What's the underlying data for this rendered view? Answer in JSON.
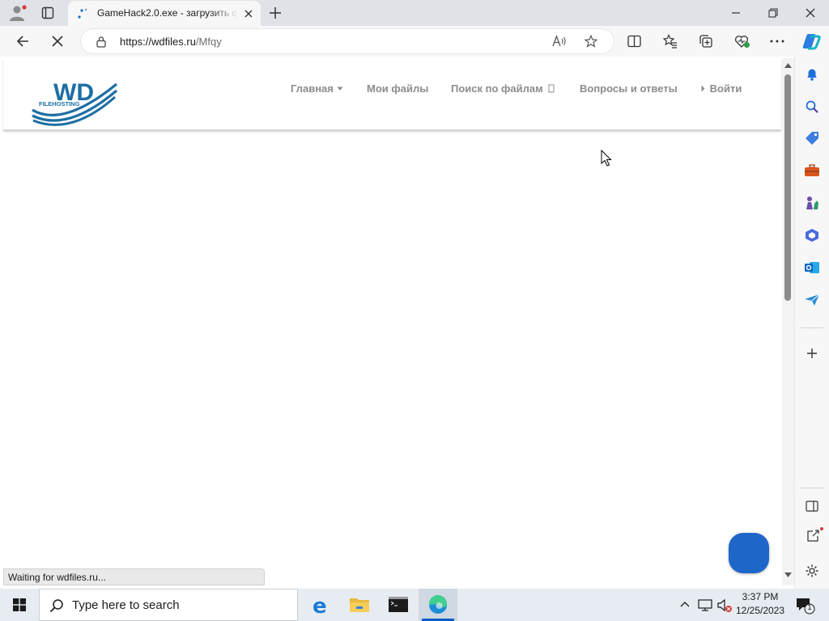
{
  "browser": {
    "tab": {
      "title": "GameHack2.0.exe - загрузить фа",
      "url_host": "https://wdfiles.ru",
      "url_path": "/Mfqy"
    },
    "status_text": "Waiting for wdfiles.ru..."
  },
  "site": {
    "logo": {
      "big": "WD",
      "small": "FILEHOSTING"
    },
    "nav": [
      {
        "label": "Главная"
      },
      {
        "label": "Мои файлы"
      },
      {
        "label": "Поиск по файлам"
      },
      {
        "label": "Вопросы и ответы"
      },
      {
        "label": "Войти"
      }
    ]
  },
  "taskbar": {
    "search_placeholder": "Type here to search",
    "time": "3:37 PM",
    "date": "12/25/2023",
    "notification_count": "1"
  },
  "colors": {
    "logo_blue": "#1c6ea4",
    "chat_bubble": "#1f66c9",
    "nav_text": "#8c8c8c"
  }
}
